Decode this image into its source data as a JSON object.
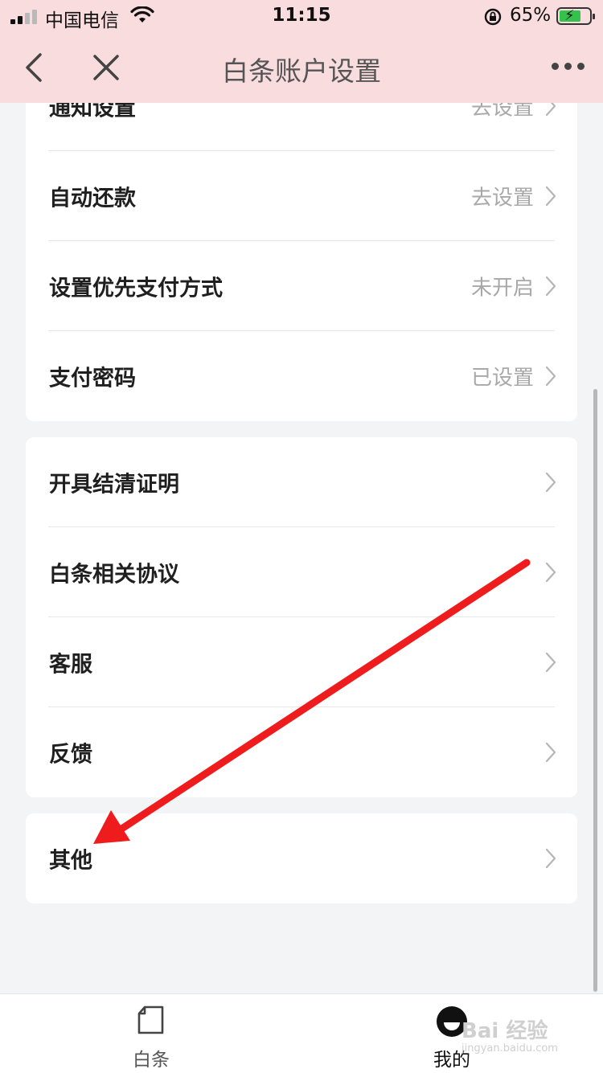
{
  "status_bar": {
    "carrier": "中国电信",
    "time": "11:15",
    "battery_percent": "65%",
    "battery_level": 0.65,
    "battery_color": "#33c24c"
  },
  "nav": {
    "title": "白条账户设置",
    "back_icon": "chevron-left-icon",
    "close_icon": "close-icon",
    "more_icon": "more-icon",
    "background": "#f9dcdd"
  },
  "settings_group_1": [
    {
      "label": "通知设置",
      "value": "去设置"
    },
    {
      "label": "自动还款",
      "value": "去设置"
    },
    {
      "label": "设置优先支付方式",
      "value": "未开启"
    },
    {
      "label": "支付密码",
      "value": "已设置"
    }
  ],
  "settings_group_2": [
    {
      "label": "开具结清证明",
      "value": ""
    },
    {
      "label": "白条相关协议",
      "value": ""
    },
    {
      "label": "客服",
      "value": ""
    },
    {
      "label": "反馈",
      "value": ""
    }
  ],
  "settings_group_3": [
    {
      "label": "其他",
      "value": ""
    }
  ],
  "tabbar": {
    "tabs": [
      {
        "label": "白条",
        "icon": "document-icon"
      },
      {
        "label": "我的",
        "icon": "profile-icon"
      }
    ]
  },
  "annotation": {
    "color": "#ee1c1c"
  },
  "watermark": {
    "text": "Bai 经验",
    "sub": "jingyan.baidu.com"
  }
}
